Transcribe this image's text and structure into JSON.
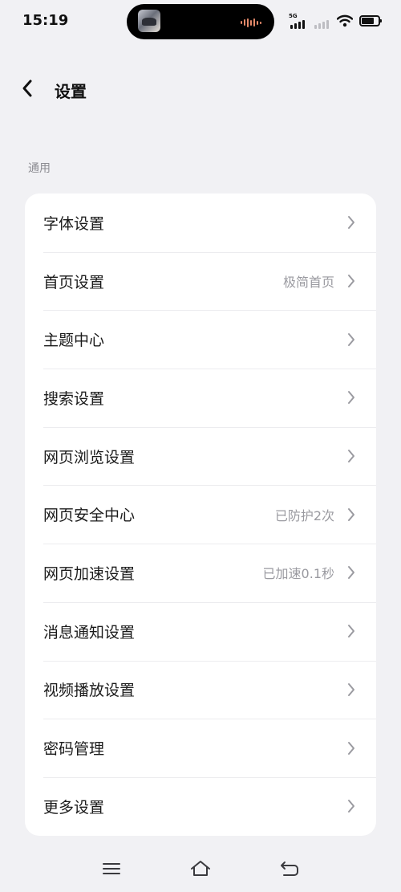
{
  "status_bar": {
    "time": "15:19",
    "network_label": "5G",
    "icons": [
      "media-thumbnail-icon",
      "audio-wave-icon",
      "signal-5g-icon",
      "signal-secondary-icon",
      "wifi-icon",
      "battery-icon"
    ]
  },
  "header": {
    "back_icon": "chevron-left-icon",
    "title": "设置"
  },
  "section": {
    "label": "通用"
  },
  "settings": {
    "items": [
      {
        "label": "字体设置",
        "value": ""
      },
      {
        "label": "首页设置",
        "value": "极简首页"
      },
      {
        "label": "主题中心",
        "value": ""
      },
      {
        "label": "搜索设置",
        "value": ""
      },
      {
        "label": "网页浏览设置",
        "value": ""
      },
      {
        "label": "网页安全中心",
        "value": "已防护2次"
      },
      {
        "label": "网页加速设置",
        "value": "已加速0.1秒"
      },
      {
        "label": "消息通知设置",
        "value": ""
      },
      {
        "label": "视频播放设置",
        "value": ""
      },
      {
        "label": "密码管理",
        "value": ""
      },
      {
        "label": "更多设置",
        "value": ""
      }
    ]
  },
  "bottom_nav": {
    "icons": [
      "menu-icon",
      "home-icon",
      "back-icon"
    ]
  },
  "colors": {
    "background": "#F1F1F4",
    "card": "#FFFFFF",
    "text_primary": "#1A1A1A",
    "text_secondary": "#9A9AA0",
    "section_label": "#8C8C92"
  }
}
